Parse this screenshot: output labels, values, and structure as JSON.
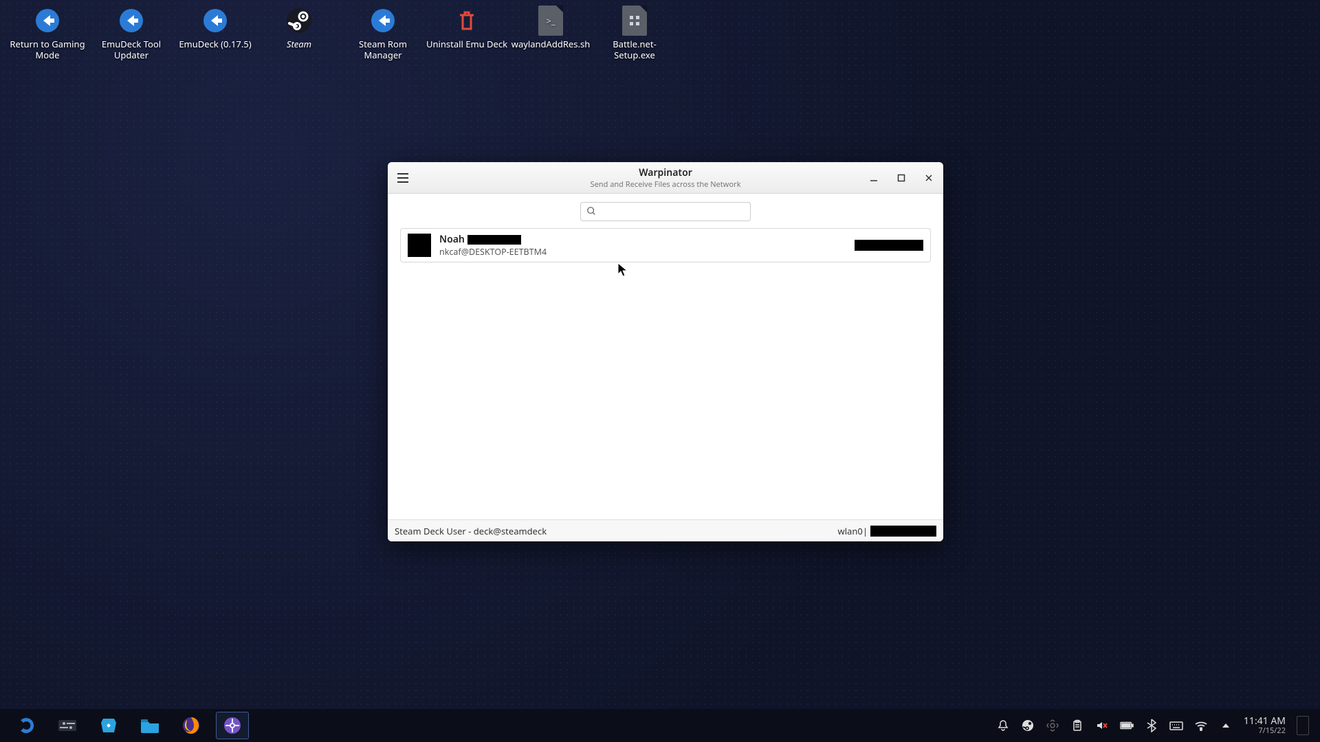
{
  "desktop": {
    "icons": [
      {
        "name": "return-gaming-mode",
        "label": "Return to Gaming Mode"
      },
      {
        "name": "emudeck-tool-updater",
        "label": "EmuDeck Tool Updater"
      },
      {
        "name": "emudeck-0-17-5",
        "label": "EmuDeck (0.17.5)"
      },
      {
        "name": "steam",
        "label": "Steam"
      },
      {
        "name": "steam-rom-manager",
        "label": "Steam Rom Manager"
      },
      {
        "name": "uninstall-emudeck",
        "label": "Uninstall Emu Deck"
      },
      {
        "name": "wayland-addres-sh",
        "label": "waylandAddRes.sh"
      },
      {
        "name": "battlenet-setup-exe",
        "label": "Battle.net-Setup.exe"
      }
    ]
  },
  "window": {
    "title": "Warpinator",
    "subtitle": "Send and Receive Files across the Network",
    "search_placeholder": "",
    "users": [
      {
        "name_prefix": "Noah",
        "subtitle": "nkcaf@DESKTOP-EETBTM4"
      }
    ],
    "status_left": "Steam Deck User - deck@steamdeck",
    "status_iface_label": "wlan0",
    "status_sep": " | "
  },
  "taskbar": {
    "items": [
      {
        "name": "start-menu",
        "title": "Application Launcher"
      },
      {
        "name": "settings",
        "title": "System Settings"
      },
      {
        "name": "discover",
        "title": "Discover"
      },
      {
        "name": "files",
        "title": "Dolphin"
      },
      {
        "name": "firefox",
        "title": "Firefox"
      },
      {
        "name": "warpinator",
        "title": "Warpinator",
        "active": true
      }
    ],
    "clock_time": "11:41 AM",
    "clock_date": "7/15/22"
  }
}
